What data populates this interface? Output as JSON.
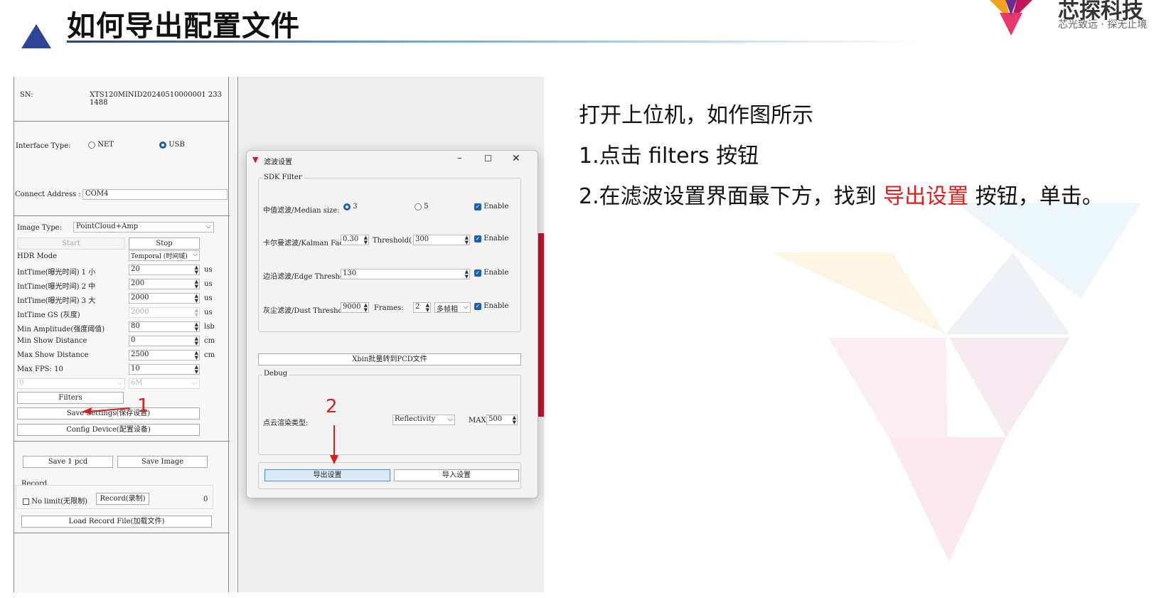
{
  "header": {
    "title": "如何导出配置文件",
    "logo_text": "芯探科技",
    "logo_subtitle": "芯光致远 · 探无止境"
  },
  "panel": {
    "sn_label": "SN:",
    "sn_value": "XTS120MINID20240510000001 233 1488",
    "interface_label": "Interface Type:",
    "opt_net": "NET",
    "opt_usb": "USB",
    "connect_label": "Connect Address :",
    "connect_value": "COM4",
    "image_type_label": "Image Type:",
    "image_type_value": "PointCloud+Amp",
    "start": "Start",
    "stop": "Stop",
    "hdr_label": "HDR Mode",
    "hdr_value": "Temporal (时间域)",
    "params": [
      {
        "label": "IntTime(曝光时间) 1 小",
        "value": "20",
        "unit": "us"
      },
      {
        "label": "IntTime(曝光时间) 2 中",
        "value": "200",
        "unit": "us"
      },
      {
        "label": "IntTime(曝光时间) 3 大",
        "value": "2000",
        "unit": "us"
      },
      {
        "label": "IntTime GS (灰度)",
        "value": "2000",
        "unit": "us"
      },
      {
        "label": "Min Amplitude(强度阈值)",
        "value": "80",
        "unit": "lsb"
      },
      {
        "label": "Min Show Distance",
        "value": "0",
        "unit": "cm"
      },
      {
        "label": "Max Show Distance",
        "value": "2500",
        "unit": "cm"
      },
      {
        "label": "Max FPS: 10",
        "value": "10",
        "unit": ""
      }
    ],
    "combo_left": "0",
    "combo_right": "6M",
    "filters": "Filters",
    "save_settings": "Save Settings(保存设置)",
    "config_device": "Config Device(配置设备)",
    "save_pcd": "Save 1 pcd",
    "save_image": "Save Image",
    "record_group": "Record",
    "no_limit": "No limit(无限制)",
    "record_btn": "Record(录制)",
    "record_count": "0",
    "load_record": "Load Record File(加载文件)"
  },
  "dialog": {
    "title": "滤波设置",
    "group_sdk": "SDK Filter",
    "median_label": "中值滤波/Median size:",
    "median_opt1": "3",
    "median_opt2": "5",
    "enable": "Enable",
    "kalman_label": "卡尔曼滤波/Kalman Fac",
    "kalman_value": "0.30",
    "threshold_label": "Threshold(",
    "threshold_value": "300",
    "edge_label": "边沿滤波/Edge Threshc",
    "edge_value": "130",
    "dust_label": "灰尘滤波/Dust Threshc",
    "dust_value": "9000",
    "frames_label": "Frames:",
    "frames_value": "2",
    "frames_mode": "多帧相",
    "xbin": "Xbin批量转到PCD文件",
    "group_debug": "Debug",
    "pc_render_label": "点云渲染类型:",
    "pc_render_value": "Reflectivity",
    "max_label": "MAX:",
    "max_value": "500",
    "export_btn": "导出设置",
    "import_btn": "导入设置"
  },
  "annotations": {
    "one": "1",
    "two": "2"
  },
  "instructions": {
    "line1": "打开上位机，如作图所示",
    "line2": "1.点击 filters 按钮",
    "line3_pre": "2.在滤波设置界面最下方，找到 ",
    "line3_highlight": "导出设置",
    "line3_post": " 按钮，单击。"
  },
  "colors": {
    "accent_blue": "#2e4495",
    "highlight_red": "#e31b1b",
    "checkbox_blue": "#1a5fb4"
  }
}
